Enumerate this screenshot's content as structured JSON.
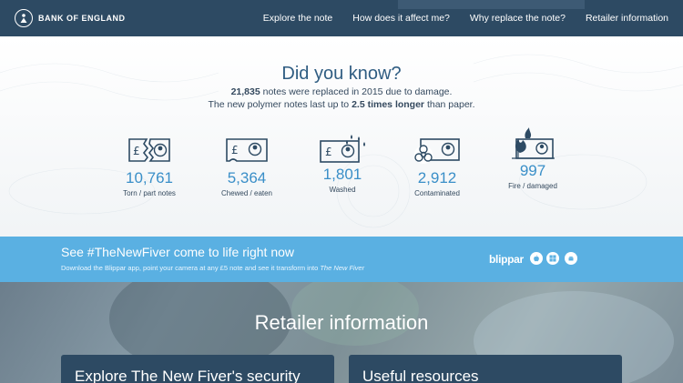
{
  "header": {
    "logo_text": "BANK OF ENGLAND",
    "nav": [
      "Explore the note",
      "How does it affect me?",
      "Why replace the note?",
      "Retailer information"
    ]
  },
  "did_you_know": {
    "title": "Did you know?",
    "line1_bold": "21,835",
    "line1_rest": " notes were replaced in 2015 due to damage.",
    "line2_start": "The new polymer notes last up to ",
    "line2_bold": "2.5 times longer",
    "line2_end": " than paper.",
    "stats": [
      {
        "value": "10,761",
        "label": "Torn / part notes",
        "icon": "torn-note-icon"
      },
      {
        "value": "5,364",
        "label": "Chewed / eaten",
        "icon": "chewed-note-icon"
      },
      {
        "value": "1,801",
        "label": "Washed",
        "icon": "washed-note-icon"
      },
      {
        "value": "2,912",
        "label": "Contaminated",
        "icon": "biohazard-note-icon"
      },
      {
        "value": "997",
        "label": "Fire / damaged",
        "icon": "fire-note-icon"
      }
    ]
  },
  "banner": {
    "title": "See #TheNewFiver come to life right now",
    "sub_start": "Download the Blippar app, point your camera at any £5 note and see it transform into ",
    "sub_italic": "The New Fiver",
    "brand": "blippar",
    "stores": [
      "apple-icon",
      "windows-icon",
      "android-icon"
    ]
  },
  "retailer": {
    "title": "Retailer information",
    "cards": [
      "Explore The New Fiver's security",
      "Useful resources"
    ]
  },
  "colors": {
    "header_bg": "#2d4a63",
    "accent_blue": "#3a8fc8",
    "banner_bg": "#5ab0e2"
  }
}
